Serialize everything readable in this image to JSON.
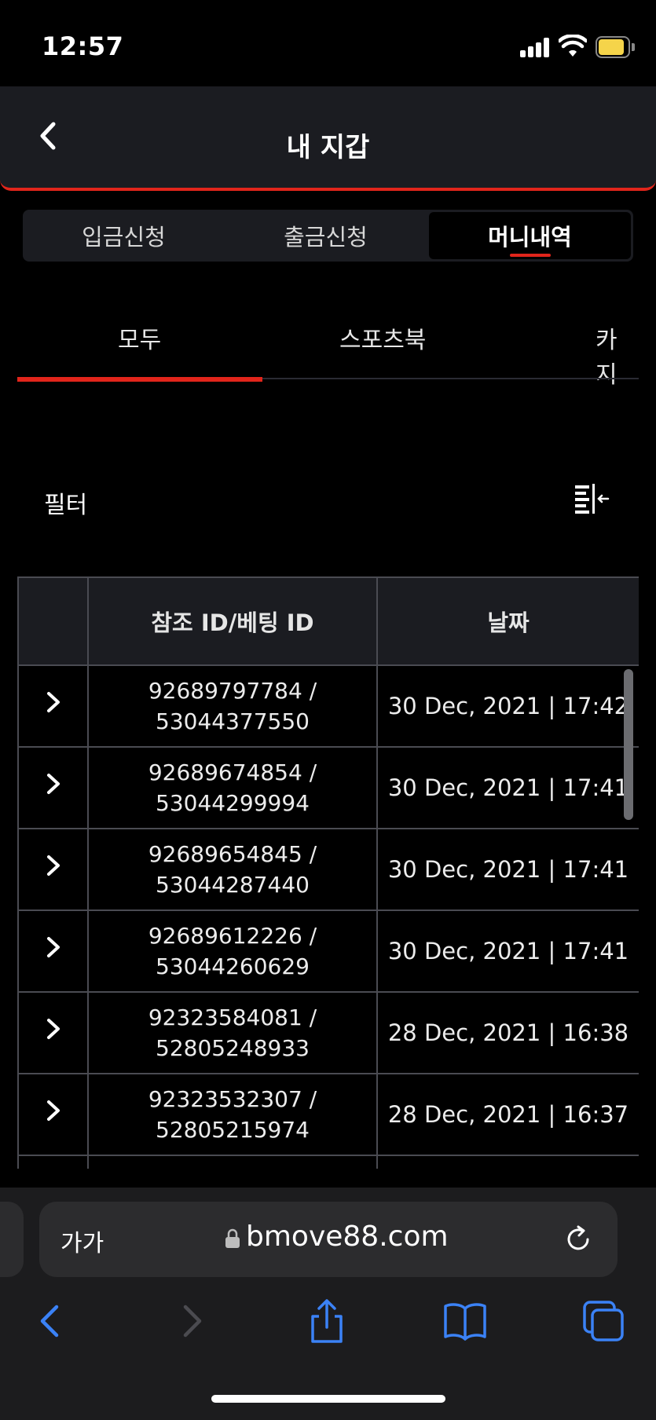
{
  "status_bar": {
    "time": "12:57"
  },
  "header": {
    "title": "내 지갑"
  },
  "main_tabs": [
    {
      "label": "입금신청",
      "active": false
    },
    {
      "label": "출금신청",
      "active": false
    },
    {
      "label": "머니내역",
      "active": true
    }
  ],
  "sub_tabs": [
    {
      "label": "모두",
      "active": true
    },
    {
      "label": "스포츠북",
      "active": false
    },
    {
      "label": "카지",
      "active": false
    }
  ],
  "filter": {
    "label": "필터"
  },
  "table": {
    "headers": [
      "",
      "참조 ID/베팅 ID",
      "날짜"
    ],
    "rows": [
      {
        "ref_id": "92689797784 /",
        "bet_id": "53044377550",
        "date": "30 Dec, 2021 | 17:42"
      },
      {
        "ref_id": "92689674854 /",
        "bet_id": "53044299994",
        "date": "30 Dec, 2021 | 17:41"
      },
      {
        "ref_id": "92689654845 /",
        "bet_id": "53044287440",
        "date": "30 Dec, 2021 | 17:41"
      },
      {
        "ref_id": "92689612226 /",
        "bet_id": "53044260629",
        "date": "30 Dec, 2021 | 17:41"
      },
      {
        "ref_id": "92323584081 /",
        "bet_id": "52805248933",
        "date": "28 Dec, 2021 | 16:38"
      },
      {
        "ref_id": "92323532307 /",
        "bet_id": "52805215974",
        "date": "28 Dec, 2021 | 16:37"
      },
      {
        "ref_id": "",
        "bet_id": "",
        "date": ""
      }
    ]
  },
  "browser": {
    "text_size_label": "가가",
    "url": "bmove88.com"
  },
  "colors": {
    "accent": "#e1251b",
    "panel": "#1b1c21",
    "background": "#000000",
    "browser_icons": "#3b82f6"
  }
}
